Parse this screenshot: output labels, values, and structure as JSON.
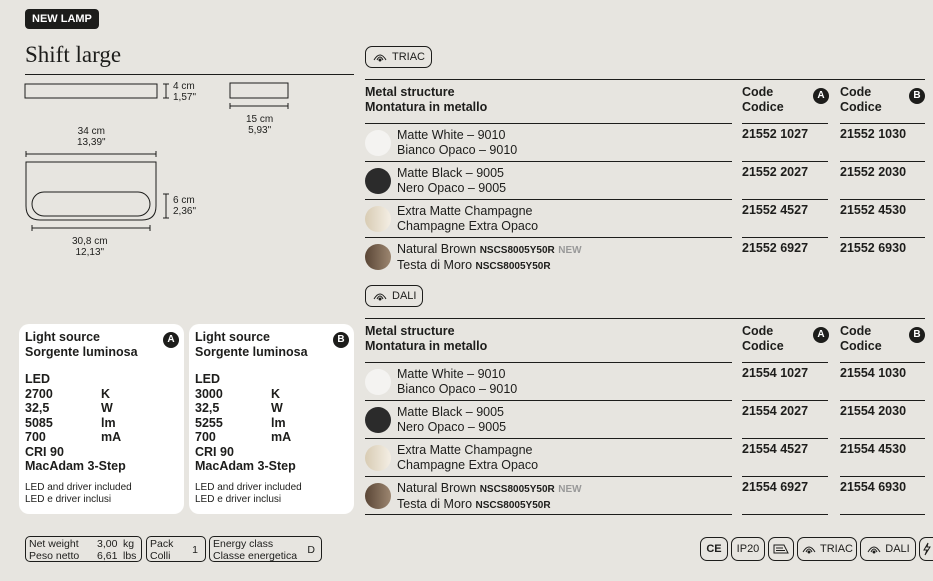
{
  "badge": "NEW LAMP",
  "title": "Shift large",
  "dimensions": {
    "height_top": "4 cm\n1,57\"",
    "width_side": "15 cm\n5,93\"",
    "width_top": "34 cm\n13,39\"",
    "height_front": "6 cm\n2,36\"",
    "width_bottom": "30,8 cm\n12,13\""
  },
  "cards": [
    {
      "title1": "Light source",
      "title2": "Sorgente luminosa",
      "letter": "A",
      "type": "LED",
      "rows": [
        [
          "2700",
          "K"
        ],
        [
          "32,5",
          "W"
        ],
        [
          "5085",
          "lm"
        ],
        [
          "700",
          "mA"
        ]
      ],
      "cri": "CRI 90",
      "macadam": "MacAdam 3-Step",
      "note1": "LED and driver included",
      "note2": "LED e driver inclusi"
    },
    {
      "title1": "Light source",
      "title2": "Sorgente luminosa",
      "letter": "B",
      "type": "LED",
      "rows": [
        [
          "3000",
          "K"
        ],
        [
          "32,5",
          "W"
        ],
        [
          "5255",
          "lm"
        ],
        [
          "700",
          "mA"
        ]
      ],
      "cri": "CRI 90",
      "macadam": "MacAdam 3-Step",
      "note1": "LED and driver included",
      "note2": "LED e driver inclusi"
    }
  ],
  "tables": [
    {
      "tag": "TRIAC",
      "head1": "Metal structure",
      "head2": "Montatura in metallo",
      "code1": "Code",
      "code2": "Codice",
      "letterA": "A",
      "letterB": "B",
      "rows": [
        {
          "name1": "Matte White – 9010",
          "name2": "Bianco Opaco – 9010",
          "a": "21552 1027",
          "b": "21552 1030",
          "color": "#f4f3f1"
        },
        {
          "name1": "Matte Black – 9005",
          "name2": "Nero Opaco – 9005",
          "a": "21552 2027",
          "b": "21552 2030",
          "color": "#2b2b2b"
        },
        {
          "name1": "Extra Matte Champagne",
          "name2": "Champagne Extra Opaco",
          "a": "21552 4527",
          "b": "21552 4530",
          "color": "#e6ddcc"
        },
        {
          "name1": "Natural Brown",
          "ncs1": "NSCS8005Y50R",
          "new": "NEW",
          "name2": "Testa di Moro",
          "ncs2": "NSCS8005Y50R",
          "a": "21552 6927",
          "b": "21552 6930",
          "color": "#6e5a48"
        }
      ]
    },
    {
      "tag": "DALI",
      "head1": "Metal structure",
      "head2": "Montatura in metallo",
      "code1": "Code",
      "code2": "Codice",
      "letterA": "A",
      "letterB": "B",
      "rows": [
        {
          "name1": "Matte White – 9010",
          "name2": "Bianco Opaco – 9010",
          "a": "21554 1027",
          "b": "21554 1030",
          "color": "#f4f3f1"
        },
        {
          "name1": "Matte Black – 9005",
          "name2": "Nero Opaco – 9005",
          "a": "21554 2027",
          "b": "21554 2030",
          "color": "#2b2b2b"
        },
        {
          "name1": "Extra Matte Champagne",
          "name2": "Champagne Extra Opaco",
          "a": "21554 4527",
          "b": "21554 4530",
          "color": "#e6ddcc"
        },
        {
          "name1": "Natural Brown",
          "ncs1": "NSCS8005Y50R",
          "new": "NEW",
          "name2": "Testa di Moro",
          "ncs2": "NSCS8005Y50R",
          "a": "21554 6927",
          "b": "21554 6930",
          "color": "#6e5a48"
        }
      ]
    }
  ],
  "footer": {
    "net_weight": "Net weight",
    "peso_netto": "Peso netto",
    "kg_val": "3,00",
    "kg": "kg",
    "lbs_val": "6,61",
    "lbs": "lbs",
    "pack": "Pack",
    "colli": "Colli",
    "pack_val": "1",
    "energy1": "Energy class",
    "energy2": "Classe energetica",
    "energy_val": "D"
  },
  "certs": {
    "ce": "CE",
    "ip": "IP20",
    "triac": "TRIAC",
    "dali": "DALI"
  }
}
